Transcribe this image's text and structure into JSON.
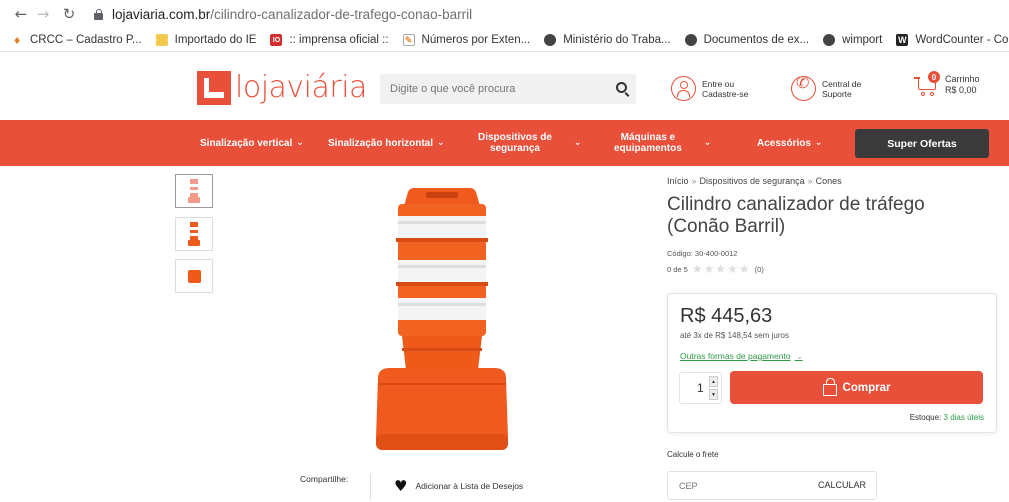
{
  "browser": {
    "url_host": "lojaviaria.com.br",
    "url_path": "/cilindro-canalizador-de-trafego-conao-barril",
    "bookmarks": [
      {
        "label": "CRCC – Cadastro P...",
        "icon": "flame-icon"
      },
      {
        "label": "Importado do IE",
        "icon": "folder-icon"
      },
      {
        "label": ":: imprensa oficial ::",
        "icon": "io-icon"
      },
      {
        "label": "Números por Exten...",
        "icon": "pen-icon"
      },
      {
        "label": "Ministério do Traba...",
        "icon": "globe-icon"
      },
      {
        "label": "Documentos de ex...",
        "icon": "globe-icon"
      },
      {
        "label": "wimport",
        "icon": "globe-icon"
      },
      {
        "label": "WordCounter - Cou...",
        "icon": "w-icon"
      }
    ]
  },
  "header": {
    "logo_text": "lojaviária",
    "search_placeholder": "Digite o que você procura",
    "login_line1": "Entre ou",
    "login_line2": "Cadastre-se",
    "support_line1": "Central de",
    "support_line2": "Suporte",
    "cart_count": "0",
    "cart_label": "Carrinho",
    "cart_total": "R$ 0,00"
  },
  "nav": {
    "items": [
      {
        "label": "Sinalização vertical"
      },
      {
        "label": "Sinalização horizontal"
      },
      {
        "label_line1": "Dispositivos de",
        "label_line2": "segurança"
      },
      {
        "label_line1": "Máquinas e",
        "label_line2": "equipamentos"
      },
      {
        "label": "Acessórios"
      }
    ],
    "offers_label": "Super Ofertas"
  },
  "breadcrumb": [
    "Início",
    "Dispositivos de segurança",
    "Cones"
  ],
  "product": {
    "title": "Cilindro canalizador de tráfego (Conão Barril)",
    "code": "Código: 30-400-0012",
    "rating_text": "0 de 5",
    "rating_value": 0,
    "rating_max": 5,
    "review_count": "(0)",
    "price": "R$ 445,63",
    "installments": "até 3x de R$ 148,54 sem juros",
    "payment_link": "Outras formas de pagamento",
    "quantity": "1",
    "buy_label": "Comprar",
    "stock_label": "Estoque:",
    "stock_days": "3 dias úteis",
    "freight_label": "Calcule o frete",
    "cep_placeholder": "CEP",
    "calc_label": "CALCULAR",
    "share_label": "Compartilhe:",
    "wishlist_label": "Adicionar à Lista de Desejos"
  },
  "colors": {
    "brand": "#e8503a",
    "offers_bg": "#3a3a3a",
    "link_green": "#2d9a46"
  }
}
